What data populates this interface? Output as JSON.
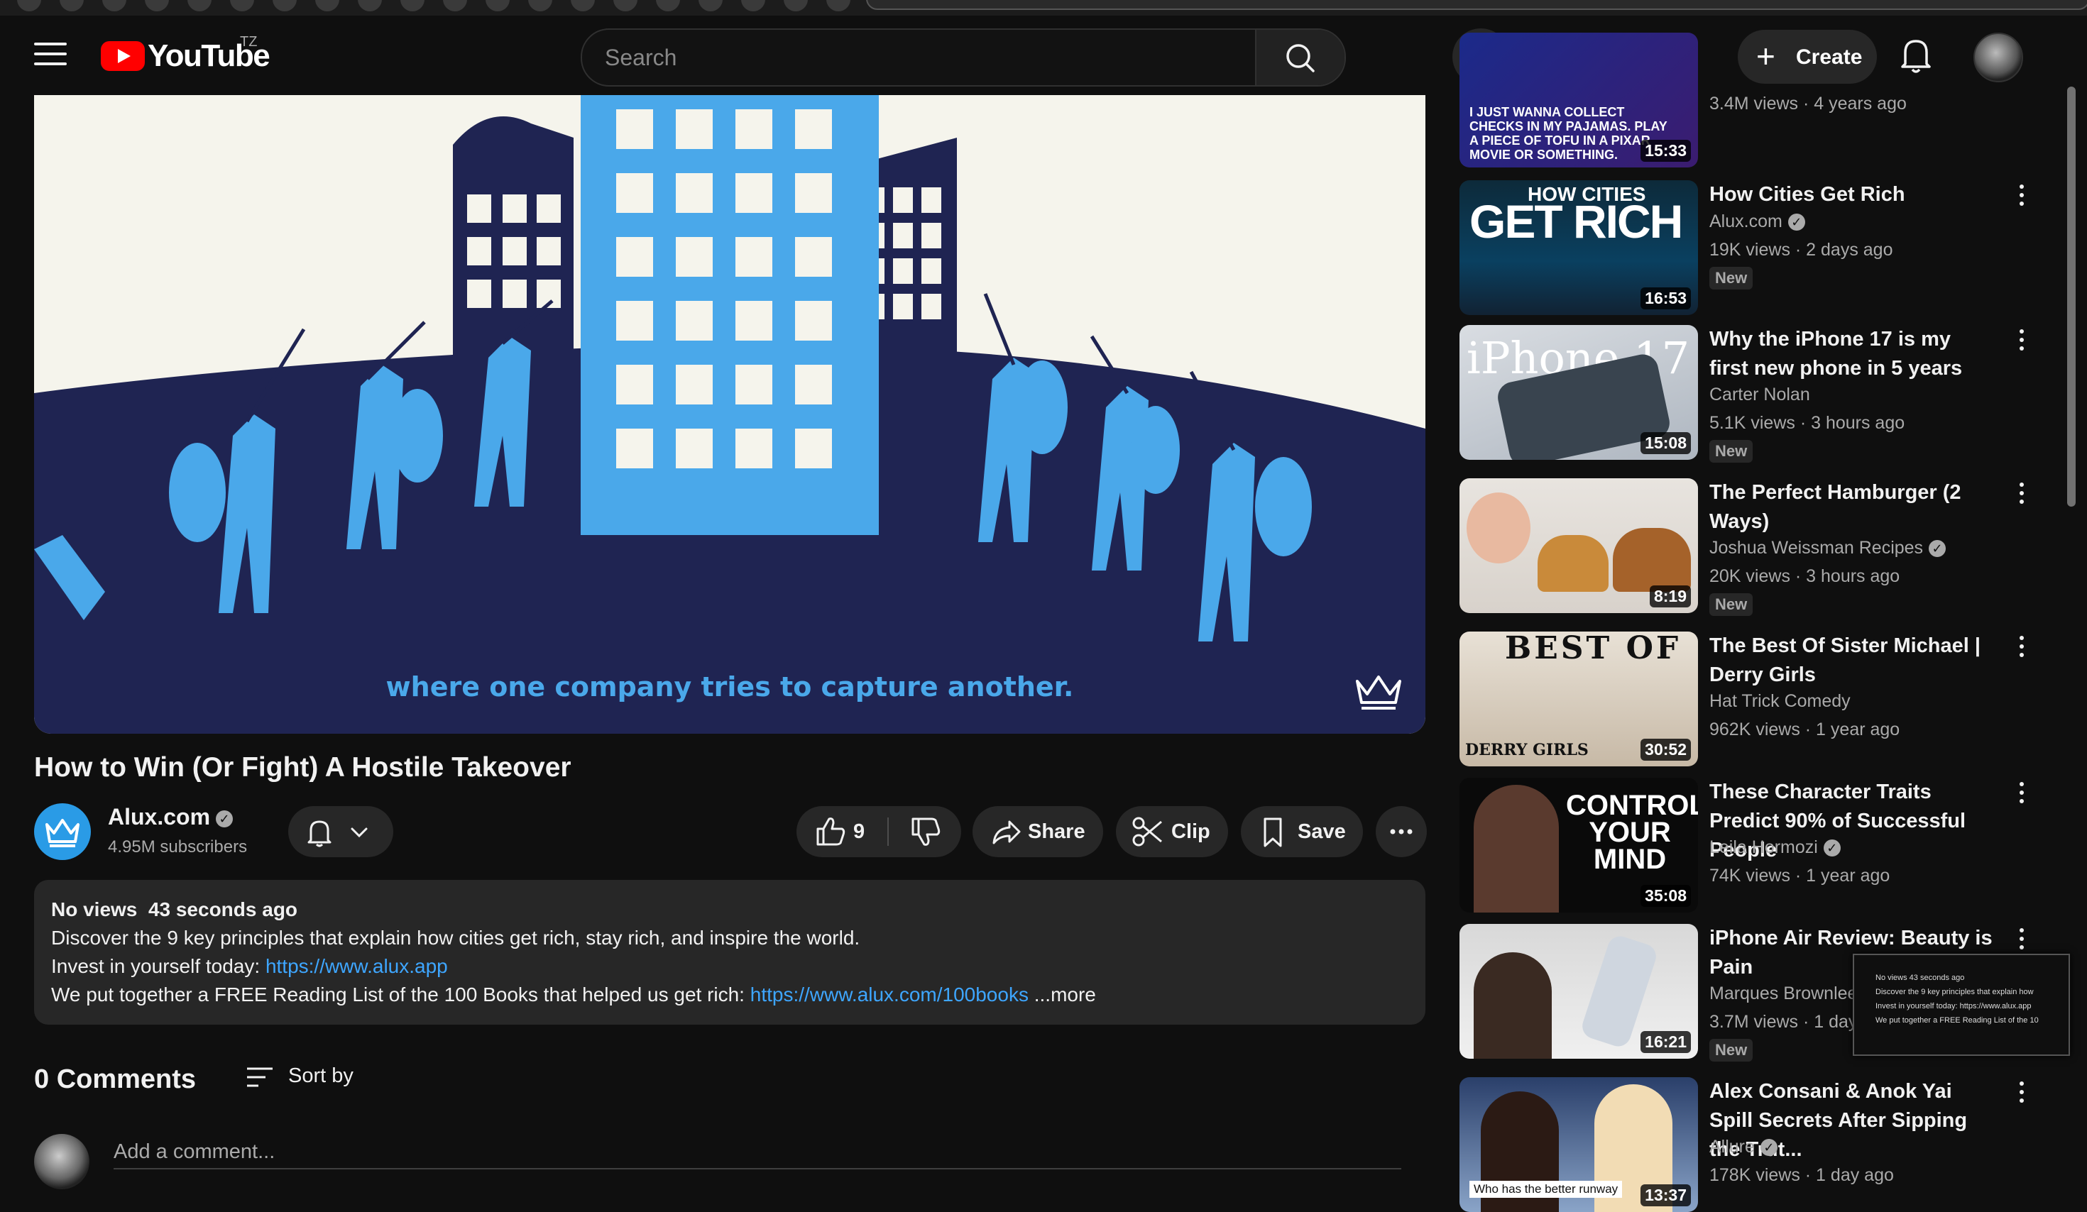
{
  "search": {
    "placeholder": "Search"
  },
  "logo": {
    "text": "YouTube",
    "country": "TZ"
  },
  "header": {
    "create_label": "Create"
  },
  "video": {
    "caption": "where one company tries to capture another.",
    "title": "How to Win (Or Fight) A Hostile Takeover",
    "channel": "Alux.com",
    "subscribers": "4.95M subscribers",
    "likes": "9",
    "share_label": "Share",
    "clip_label": "Clip",
    "save_label": "Save"
  },
  "description": {
    "meta": "No views  43 seconds ago",
    "line1": "Discover the 9 key principles that explain how cities get rich, stay rich, and inspire the world.",
    "line2_text": "Invest in yourself today: ",
    "line2_link": "https://www.alux.app",
    "line3_text": "We put together a FREE Reading List of the 100 Books that helped us get rich: ",
    "line3_link": "https://www.alux.com/100books",
    "more": "...more"
  },
  "comments": {
    "count_label": "0 Comments",
    "sort_label": "Sort by",
    "placeholder": "Add a comment..."
  },
  "recommendations": [
    {
      "title": "",
      "channel": "",
      "meta": "3.4M views · 4 years ago",
      "duration": "15:33",
      "thumb_text": "I JUST WANNA COLLECT CHECKS IN MY PAJAMAS. PLAY A PIECE OF TOFU IN A PIXAR MOVIE OR SOMETHING."
    },
    {
      "title": "How Cities Get Rich",
      "channel": "Alux.com",
      "verified": true,
      "meta": "19K views · 2 days ago",
      "duration": "16:53",
      "badge": "New",
      "thumb_text1": "HOW CITIES",
      "thumb_text2": "GET RICH"
    },
    {
      "title": "Why the iPhone 17 is my first new phone in 5 years",
      "channel": "Carter Nolan",
      "meta": "5.1K views · 3 hours ago",
      "duration": "15:08",
      "badge": "New",
      "thumb_text": "iPhone 17"
    },
    {
      "title": "The Perfect Hamburger (2 Ways)",
      "channel": "Joshua Weissman Recipes",
      "verified": true,
      "meta": "20K views · 3 hours ago",
      "duration": "8:19",
      "badge": "New"
    },
    {
      "title": "The Best Of Sister Michael | Derry Girls",
      "channel": "Hat Trick Comedy",
      "meta": "962K views · 1 year ago",
      "duration": "30:52",
      "thumb_text1": "BEST OF",
      "thumb_text2": "DERRY GIRLS"
    },
    {
      "title": "These Character Traits Predict 90% of Successful People",
      "channel": "Leila Hormozi",
      "verified": true,
      "meta": "74K views · 1 year ago",
      "duration": "35:08",
      "thumb_text": "CONTROL YOUR MIND"
    },
    {
      "title": "iPhone Air Review: Beauty is Pain",
      "channel": "Marques Brownlee",
      "meta": "3.7M views · 1 day",
      "duration": "16:21",
      "badge": "New"
    },
    {
      "title": "Alex Consani & Anok Yai Spill Secrets After Sipping the Trut...",
      "channel": "Allure",
      "verified": true,
      "meta": "178K views · 1 day ago",
      "duration": "13:37",
      "thumb_text": "Who has the better runway"
    }
  ],
  "hover_card": {
    "line1": "No views  43 seconds ago",
    "line2": "Discover the 9 key principles that explain how",
    "line3": "Invest in yourself today: https://www.alux.app",
    "line4": "We put together a FREE Reading List of the 10"
  }
}
